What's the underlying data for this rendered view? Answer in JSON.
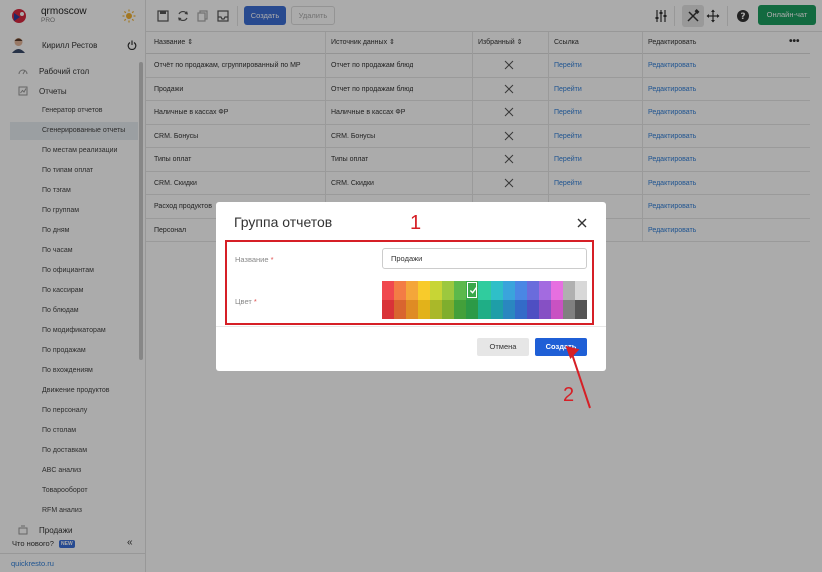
{
  "brand": {
    "name": "qrmoscow",
    "plan": "PRO"
  },
  "user": {
    "name": "Кирилл Рестов"
  },
  "sidebar": {
    "top_items": [
      {
        "label": "Рабочий стол",
        "icon": "dashboard-icon"
      },
      {
        "label": "Отчеты",
        "icon": "reports-icon"
      }
    ],
    "sub_items": [
      "Генератор отчетов",
      "Сгенерированные отчеты",
      "По местам реализации",
      "По типам оплат",
      "По тэгам",
      "По группам",
      "По дням",
      "По часам",
      "По официантам",
      "По кассирам",
      "По блюдам",
      "По модификаторам",
      "По продажам",
      "По вхождениям",
      "Движение продуктов",
      "По персоналу",
      "По столам",
      "По доставкам",
      "ABC анализ",
      "Товарооборот",
      "RFM анализ"
    ],
    "active_sub_index": 1,
    "bottom_item": {
      "label": "Продажи",
      "icon": "sales-icon"
    },
    "whats_new": "Что нового?",
    "new_badge": "NEW",
    "collapse_glyph": "«",
    "site": "quickresto.ru"
  },
  "toolbar": {
    "create_label": "Создать",
    "delete_label": "Удалить",
    "chat_label": "Онлайн-чат"
  },
  "table": {
    "headers": {
      "name": "Название ⇕",
      "source": "Источник данных ⇕",
      "favorite": "Избранный ⇕",
      "link": "Ссылка",
      "edit": "Редактировать",
      "more": "•••"
    },
    "rows": [
      {
        "name": "Отчёт по продажам, сгруппированный по МР",
        "source": "Отчет по продажам блюд",
        "link": "Перейти",
        "edit": "Редактировать"
      },
      {
        "name": "Продажи",
        "source": "Отчет по продажам блюд",
        "link": "Перейти",
        "edit": "Редактировать"
      },
      {
        "name": "Наличные в кассах ФР",
        "source": "Наличные в кассах ФР",
        "link": "Перейти",
        "edit": "Редактировать"
      },
      {
        "name": "CRM. Бонусы",
        "source": "CRM. Бонусы",
        "link": "Перейти",
        "edit": "Редактировать"
      },
      {
        "name": "Типы оплат",
        "source": "Типы оплат",
        "link": "Перейти",
        "edit": "Редактировать"
      },
      {
        "name": "CRM. Скидки",
        "source": "CRM. Скидки",
        "link": "Перейти",
        "edit": "Редактировать"
      },
      {
        "name": "Расход продуктов",
        "source": "",
        "link": "",
        "edit": "Редактировать"
      },
      {
        "name": "Персонал",
        "source": "",
        "link": "",
        "edit": "Редактировать"
      }
    ]
  },
  "modal": {
    "title": "Группа отчетов",
    "name_label": "Название",
    "color_label": "Цвет",
    "required_mark": "*",
    "name_value": "Продажи",
    "cancel_label": "Отмена",
    "submit_label": "Создать",
    "selected_color_index": 7,
    "colors_top": [
      "#f0484e",
      "#f37c45",
      "#f4a63a",
      "#f8cb2b",
      "#c8d535",
      "#9cc83e",
      "#5cb94b",
      "#3aa84a",
      "#30cc9e",
      "#2fbfc8",
      "#3aa4dc",
      "#4a87e4",
      "#6a6cdc",
      "#a36be0",
      "#e66fe0",
      "#b0b0b0",
      "#d8d8d8"
    ],
    "colors_bottom": [
      "#d93338",
      "#d9652f",
      "#df8b24",
      "#e2b21a",
      "#aab829",
      "#7fae2d",
      "#43a03a",
      "#2c9a46",
      "#1fae86",
      "#1e9ea8",
      "#2a87c0",
      "#336bc8",
      "#4e4fc2",
      "#8650c4",
      "#c952c2",
      "#808080",
      "#555555"
    ]
  },
  "annotations": {
    "step1": "1",
    "step2": "2"
  }
}
